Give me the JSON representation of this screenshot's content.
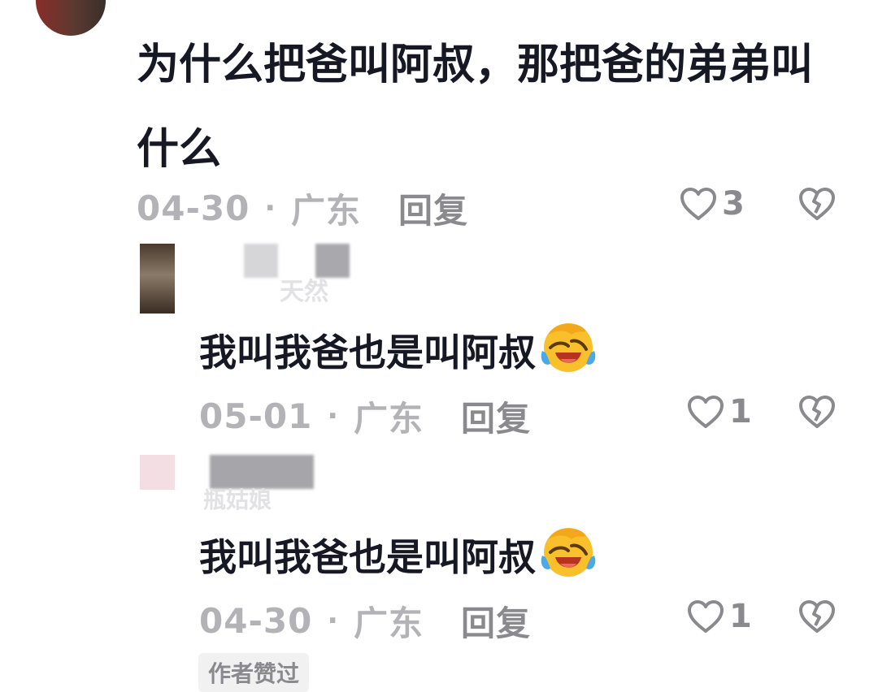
{
  "comments": [
    {
      "text_line1": "为什么把爸叫阿叔，那把爸的弟弟叫",
      "text_line2": "什么",
      "date": "04-30",
      "dot": "·",
      "location": "广东",
      "reply": "回复",
      "likes": "3"
    },
    {
      "username_fragment": "天然",
      "text": "我叫我爸也是叫阿叔",
      "emoji": "face-with-tears-of-joy-icon",
      "date": "05-01",
      "dot": "·",
      "location": "广东",
      "reply": "回复",
      "likes": "1"
    },
    {
      "username_fragment": "瓶姑娘",
      "text": "我叫我爸也是叫阿叔",
      "emoji": "face-with-tears-of-joy-icon",
      "date": "04-30",
      "dot": "·",
      "location": "广东",
      "reply": "回复",
      "likes": "1"
    }
  ],
  "author_tag": "作者赞过",
  "colors": {
    "text": "#161823",
    "meta": "#b3b3b7",
    "reply": "#8a8a8e",
    "background": "#ffffff"
  }
}
